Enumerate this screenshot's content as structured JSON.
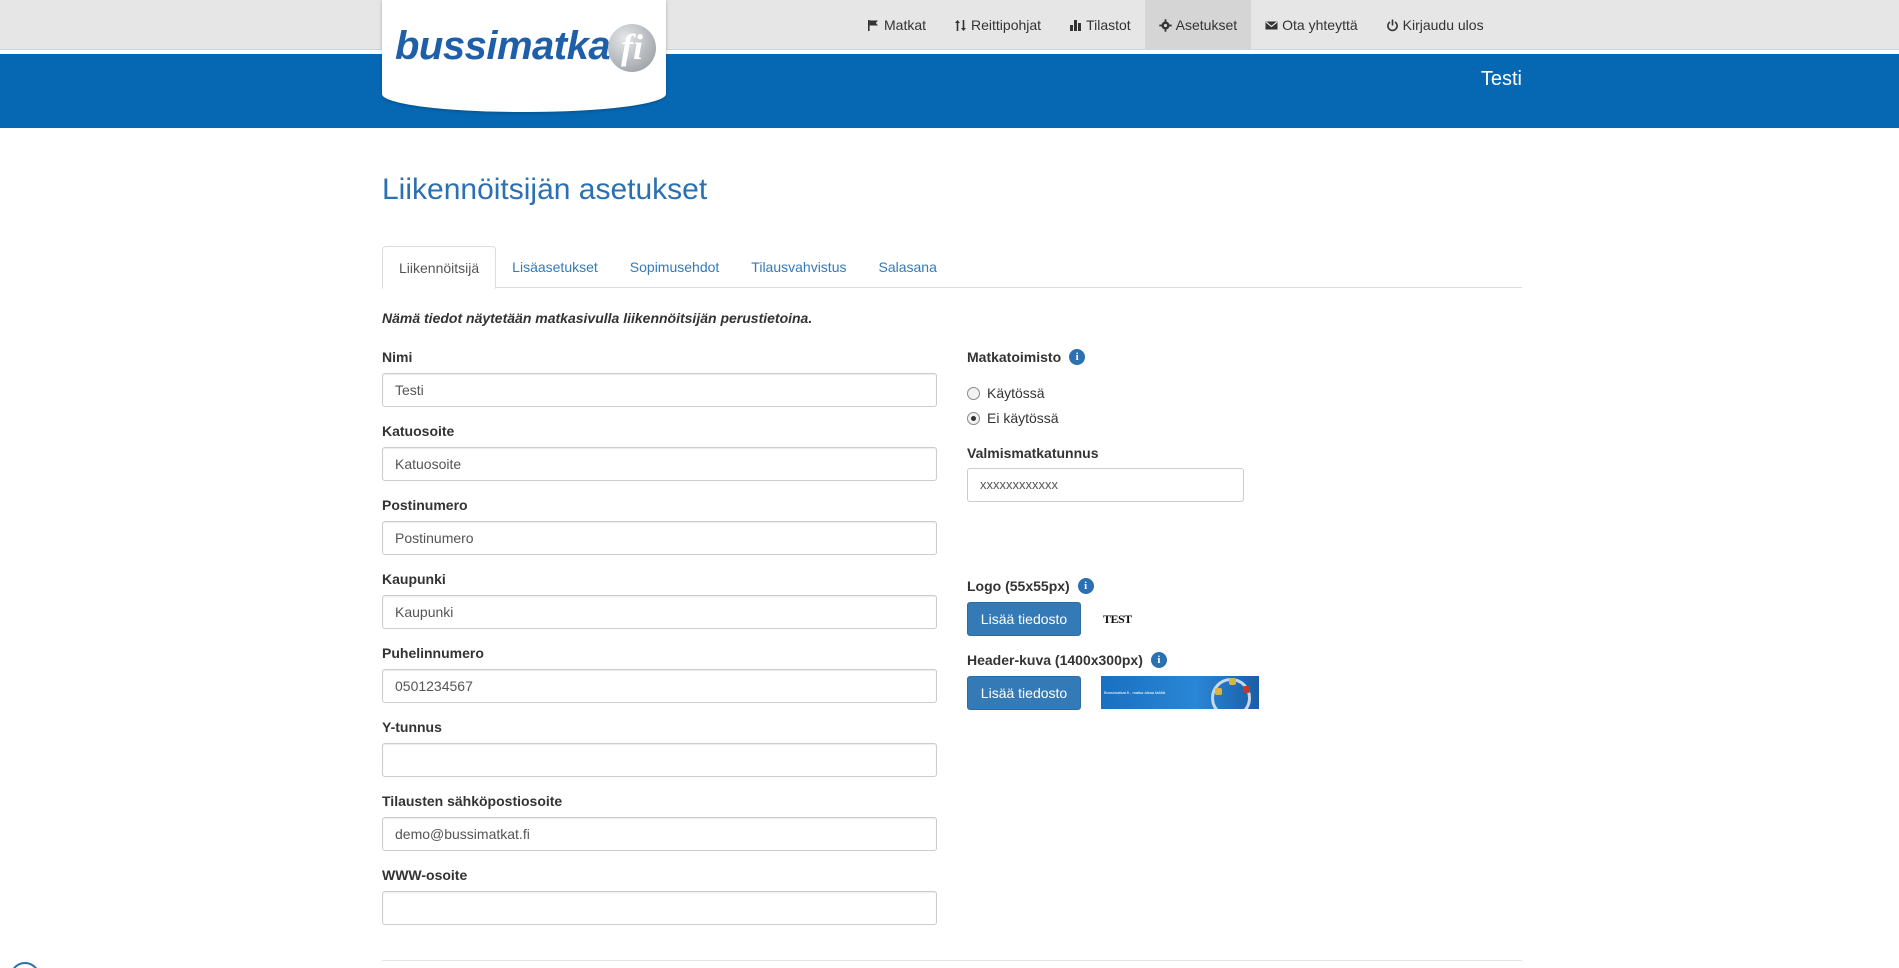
{
  "brand": {
    "logo_text": "bussimatkat",
    "logo_suffix": "fi"
  },
  "nav": {
    "items": [
      {
        "label": "Matkat",
        "icon": "flag-icon"
      },
      {
        "label": "Reittipohjat",
        "icon": "sort-arrows-icon"
      },
      {
        "label": "Tilastot",
        "icon": "bar-chart-icon"
      },
      {
        "label": "Asetukset",
        "icon": "gear-icon",
        "active": true
      },
      {
        "label": "Ota yhteyttä",
        "icon": "envelope-icon"
      },
      {
        "label": "Kirjaudu ulos",
        "icon": "power-icon"
      }
    ]
  },
  "header": {
    "user": "Testi"
  },
  "page": {
    "title": "Liikennöitsijän asetukset"
  },
  "tabs": [
    {
      "label": "Liikennöitsijä",
      "active": true
    },
    {
      "label": "Lisäasetukset"
    },
    {
      "label": "Sopimusehdot"
    },
    {
      "label": "Tilausvahvistus"
    },
    {
      "label": "Salasana"
    }
  ],
  "form": {
    "intro": "Nämä tiedot näytetään matkasivulla liikennöitsijän perustietoina.",
    "fields": [
      {
        "label": "Nimi",
        "value": "Testi"
      },
      {
        "label": "Katuosoite",
        "value": "",
        "placeholder": "Katuosoite"
      },
      {
        "label": "Postinumero",
        "value": "",
        "placeholder": "Postinumero"
      },
      {
        "label": "Kaupunki",
        "value": "",
        "placeholder": "Kaupunki"
      },
      {
        "label": "Puhelinnumero",
        "value": "0501234567"
      },
      {
        "label": "Y-tunnus",
        "value": ""
      },
      {
        "label": "Tilausten sähköpostiosoite",
        "value": "demo@bussimatkat.fi"
      },
      {
        "label": "WWW-osoite",
        "value": ""
      }
    ],
    "matkatoimisto": {
      "label": "Matkatoimisto",
      "options": [
        {
          "label": "Käytössä",
          "checked": false
        },
        {
          "label": "Ei käytössä",
          "checked": true
        }
      ]
    },
    "valmismatkatunnus": {
      "label": "Valmismatkatunnus",
      "value": "xxxxxxxxxxxx"
    },
    "logo": {
      "label": "Logo (55x55px)",
      "button": "Lisää tiedosto",
      "preview_text": "TEST"
    },
    "header_image": {
      "label": "Header-kuva (1400x300px)",
      "button": "Lisää tiedosto",
      "caption": "Bussimatkat.fi - matka alkaa täältä"
    }
  },
  "colors": {
    "brand_blue": "#0668b3",
    "link_blue": "#337ab7",
    "title_blue": "#2b70b1"
  }
}
